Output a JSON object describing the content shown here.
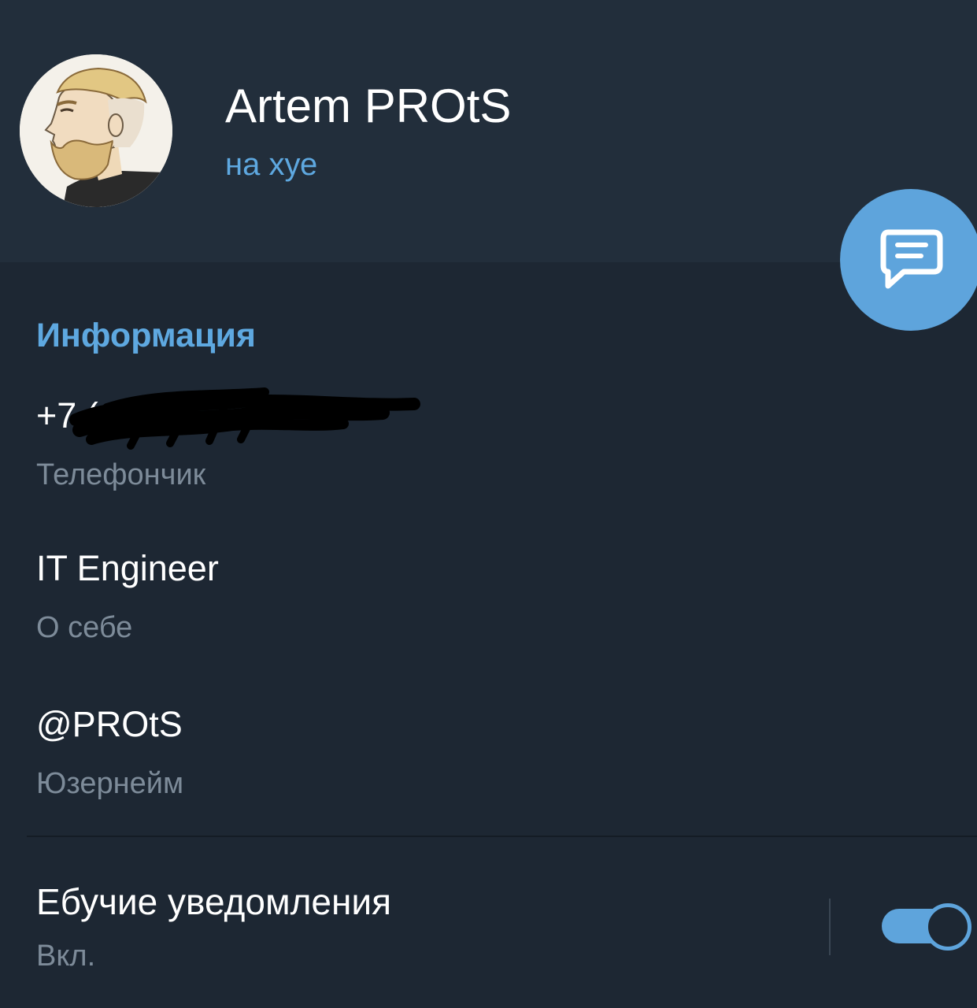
{
  "profile": {
    "name": "Artem PROtS",
    "status": "на хуе"
  },
  "fab": {
    "icon": "message-icon"
  },
  "info": {
    "section_title": "Информация",
    "phone": {
      "value": "+7 (•••) •••-••-15",
      "label": "Телефончик"
    },
    "bio": {
      "value": "IT Engineer",
      "label": "О себе"
    },
    "username": {
      "value": "@PROtS",
      "label": "Юзернейм"
    }
  },
  "notifications": {
    "title": "Ебучие уведомления",
    "status": "Вкл.",
    "enabled": true
  },
  "colors": {
    "background": "#1d2733",
    "header": "#222e3b",
    "accent": "#5ea4dc",
    "secondary_text": "#7d8b99"
  }
}
